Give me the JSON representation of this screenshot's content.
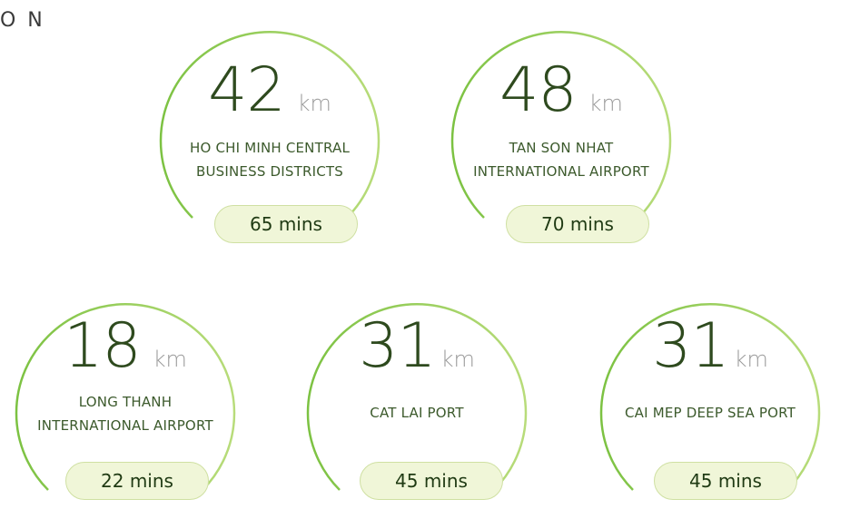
{
  "header": {
    "partial_title": "O N"
  },
  "cards": [
    {
      "distance": "42",
      "unit": "km",
      "place_line1": "HO CHI MINH CENTRAL",
      "place_line2": "BUSINESS DISTRICTS",
      "time": "65 mins"
    },
    {
      "distance": "48",
      "unit": "km",
      "place_line1": "TAN SON NHAT",
      "place_line2": "INTERNATIONAL AIRPORT",
      "time": "70 mins"
    },
    {
      "distance": "18",
      "unit": "km",
      "place_line1": "LONG THANH",
      "place_line2": "INTERNATIONAL AIRPORT",
      "time": "22 mins"
    },
    {
      "distance": "31",
      "unit": "km",
      "place_line1": "CAT LAI PORT",
      "place_line2": "",
      "time": "45 mins"
    },
    {
      "distance": "31",
      "unit": "km",
      "place_line1": "CAI MEP DEEP SEA PORT",
      "place_line2": "",
      "time": "45 mins"
    }
  ],
  "colors": {
    "arc_start": "#7cc242",
    "arc_end": "#b8dc7a",
    "number": "#2e4a1e",
    "pill_bg": "#f0f6d8"
  }
}
